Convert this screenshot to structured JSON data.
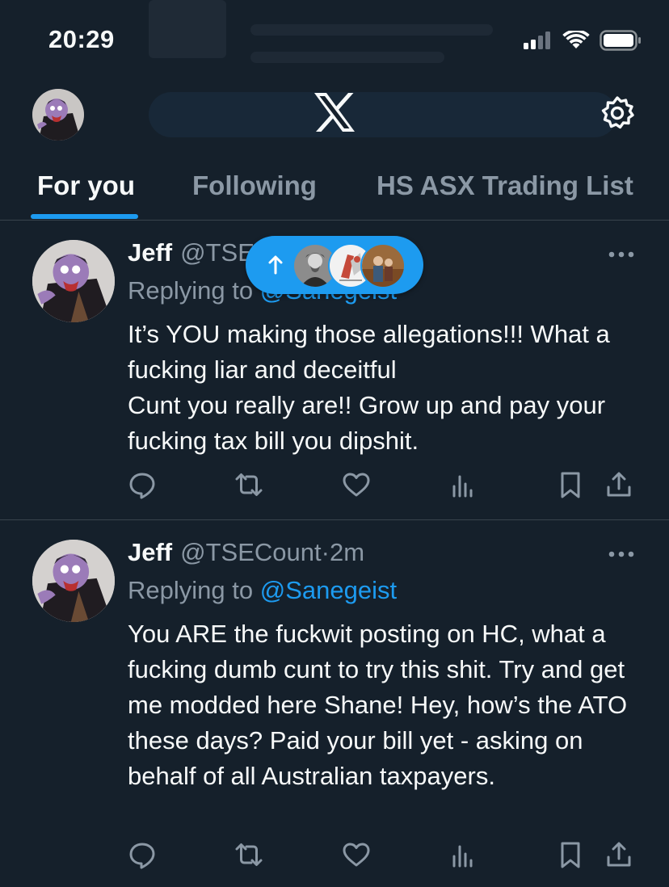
{
  "status_bar": {
    "time": "20:29"
  },
  "header": {
    "logo_icon": "x-logo-icon",
    "settings_icon": "gear-icon"
  },
  "tabs": [
    {
      "label": "For you",
      "active": true
    },
    {
      "label": "Following",
      "active": false
    },
    {
      "label": "HS ASX Trading List",
      "active": false
    }
  ],
  "tweets": [
    {
      "name": "Jeff",
      "handle": "@TSE",
      "time": "",
      "reply_label": "Replying to",
      "reply_handle": "@Sanegeist",
      "text": "It’s YOU making those allegations!!! What a fucking liar and deceitful\nCunt you really are!! Grow up and pay your fucking tax bill you dipshit."
    },
    {
      "name": "Jeff",
      "handle": "@TSECount",
      "time": "·2m",
      "reply_label": "Replying to",
      "reply_handle": "@Sanegeist",
      "text": "You ARE the fuckwit posting on HC, what a fucking dumb cunt to try this shit. Try and get me modded here Shane! Hey, how’s the ATO these days? Paid your bill yet - asking on behalf of all Australian taxpayers."
    }
  ],
  "new_posts_pill": {
    "icon": "arrow-up-icon"
  },
  "colors": {
    "accent": "#1d9bf0",
    "background": "#15202b",
    "muted": "#8b98a5"
  }
}
